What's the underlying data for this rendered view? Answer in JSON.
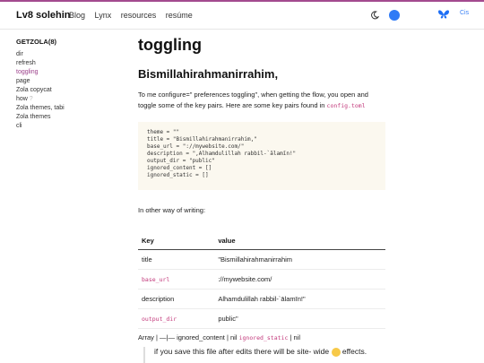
{
  "header": {
    "brand": "Lv8 solehin",
    "nav": [
      "Blog",
      "Lynx",
      "resources",
      "resúme"
    ],
    "lang": "Cis"
  },
  "sidebar": {
    "title": "GETZOLA(8)",
    "items": [
      {
        "label": "dir"
      },
      {
        "label": "refresh"
      },
      {
        "label": "toggling",
        "active": true
      },
      {
        "label": "page"
      },
      {
        "label": "Zola copycat"
      },
      {
        "label": "how",
        "suffix": "?"
      },
      {
        "label": "Zola themes, tabi"
      },
      {
        "label": "Zola themes"
      },
      {
        "label": "cli"
      }
    ]
  },
  "main": {
    "title": "toggling",
    "subtitle": "Bismillahirahmanirrahim,",
    "para_before": "To me configure=\" preferences toggling\", when getting the flow, you open and toggle some of the key pairs. Here are some key pairs found in",
    "para_code": "config.toml",
    "code_lines": [
      "theme = \"\"",
      "title = \"Bismillahirahmanirrahim,\"",
      "base_url = \"://mywebsite.com/\"",
      "description = \",Alhamdulillah rabbil-`ālamīn!\"",
      "output_dir = \"public\"",
      "ignored_content = []",
      "ignored_static = []"
    ],
    "alt_text": "In other way of writing:",
    "table": {
      "headers": [
        "Key",
        "value"
      ],
      "rows": [
        {
          "key": "title",
          "key_code": false,
          "value": "\"Bismillahirahmanirrahim"
        },
        {
          "key": "base_url",
          "key_code": true,
          "value": "://mywebsite.com/"
        },
        {
          "key": "description",
          "key_code": false,
          "value": "Alhamdulillah rabbil-`ālamīn!\""
        },
        {
          "key": "output_dir",
          "key_code": true,
          "value": "public\""
        }
      ]
    },
    "array_prefix": "Array | —|— ignored_content | nil",
    "array_code": "ignored_static",
    "array_suffix": "| nil",
    "quote": "if you save this file after edits there will be site- wide",
    "quote_end": "effects."
  },
  "colors": {
    "accent": "#a34a8f",
    "code": "#c2377a",
    "code_bg": "#fbf8ef",
    "link": "#3b82f6"
  }
}
